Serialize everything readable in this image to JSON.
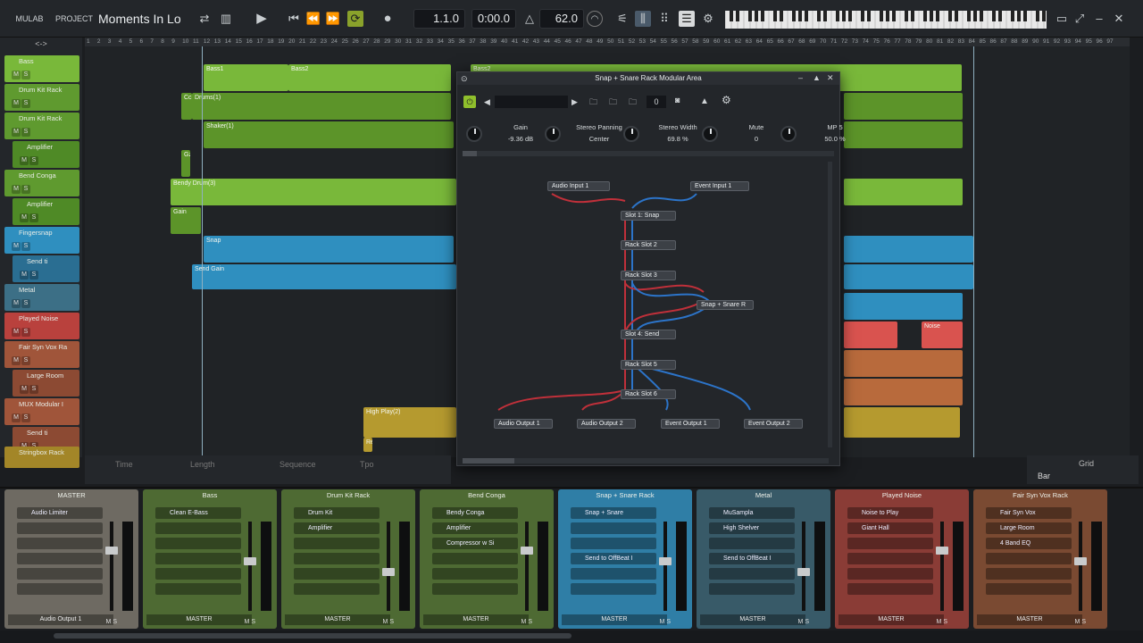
{
  "toolbar": {
    "brand": "MULAB",
    "project": "PROJECT",
    "song_title": "Moments In Lo",
    "position": "1.1.0",
    "time": "0:00.0",
    "tempo": "62.0"
  },
  "tracks": [
    {
      "name": "Bass",
      "color": "#79b83a"
    },
    {
      "name": "Drum Kit Rack",
      "color": "#5f9a2f"
    },
    {
      "name": "Drum Kit Rack",
      "color": "#5f9a2f"
    },
    {
      "name": "Amplifier",
      "color": "#4f8a26"
    },
    {
      "name": "Bend Conga",
      "color": "#5f9a2f"
    },
    {
      "name": "Amplifier",
      "color": "#4f8a26"
    },
    {
      "name": "Fingersnap",
      "color": "#2f8fbf"
    },
    {
      "name": "Send ti",
      "color": "#2a6e92"
    },
    {
      "name": "Metal",
      "color": "#3c6f86"
    },
    {
      "name": "Played Noise",
      "color": "#b9413d"
    },
    {
      "name": "Fair Syn Vox Ra",
      "color": "#a0553a"
    },
    {
      "name": "Large Room",
      "color": "#8c4a33"
    },
    {
      "name": "MUX Modular I",
      "color": "#a0553a"
    },
    {
      "name": "Send ti",
      "color": "#8c4a33"
    },
    {
      "name": "Stringbox Rack",
      "color": "#a38628"
    }
  ],
  "clips": [
    {
      "label": "Bass1"
    },
    {
      "label": "Bass2"
    },
    {
      "label": "Bass2"
    },
    {
      "label": "Drums(1)"
    },
    {
      "label": "Cc"
    },
    {
      "label": "Shaker(1)"
    },
    {
      "label": "Gz"
    },
    {
      "label": "Bendy Drum(3)"
    },
    {
      "label": "Gain"
    },
    {
      "label": "Snap"
    },
    {
      "label": "Send Gain"
    },
    {
      "label": "Noise"
    },
    {
      "label": "High Play(2)"
    },
    {
      "label": "Re"
    }
  ],
  "ruler": [
    "1",
    "2",
    "3",
    "4",
    "5",
    "6",
    "7",
    "8",
    "9",
    "10",
    "11",
    "12",
    "13",
    "14",
    "15",
    "16",
    "17",
    "18",
    "19",
    "20",
    "21",
    "22",
    "23",
    "24",
    "25",
    "26",
    "27",
    "28",
    "29",
    "30",
    "31",
    "32",
    "33",
    "34",
    "35",
    "36",
    "37",
    "38",
    "39",
    "40",
    "41",
    "42",
    "43",
    "44",
    "45",
    "46",
    "47",
    "48",
    "49",
    "50",
    "51",
    "52",
    "53",
    "54",
    "55",
    "56",
    "57",
    "58",
    "59",
    "60",
    "61",
    "62",
    "63",
    "64",
    "65",
    "66",
    "67",
    "68",
    "69",
    "70",
    "71",
    "72",
    "73",
    "74",
    "75",
    "76",
    "77",
    "78",
    "79",
    "80",
    "81",
    "82",
    "83",
    "84",
    "85",
    "86",
    "87",
    "88",
    "89",
    "90",
    "91",
    "92",
    "93",
    "94",
    "95",
    "96",
    "97"
  ],
  "rack": {
    "title": "Snap + Snare Rack Modular Area",
    "preset_number": "0",
    "params": [
      {
        "name": "Gain",
        "value": "-9.36 dB"
      },
      {
        "name": "Stereo Panning",
        "value": "Center"
      },
      {
        "name": "Stereo Width",
        "value": "69.8 %"
      },
      {
        "name": "Mute",
        "value": "0"
      },
      {
        "name": "MP 5",
        "value": "50.0 %"
      }
    ],
    "nodes": {
      "audio_in": "Audio Input 1",
      "event_in": "Event Input 1",
      "slot1": "Slot 1: Snap",
      "slot2": "Rack Slot 2",
      "slot3": "Rack Slot 3",
      "snap": "Snap + Snare R",
      "slot4": "Slot 4: Send",
      "slot5": "Rack Slot 5",
      "slot6": "Rack Slot 6",
      "aout1": "Audio Output 1",
      "aout2": "Audio Output 2",
      "eout1": "Event Output 1",
      "eout2": "Event Output 2"
    }
  },
  "bottom": {
    "time": "Time",
    "length": "Length",
    "sequence": "Sequence",
    "tpo": "Tpo",
    "grid_label": "Grid",
    "grid_value": "Bar"
  },
  "mixer": [
    {
      "name": "MASTER",
      "color": "#6e6a62",
      "slots": [
        "Audio Limiter"
      ],
      "out": "Audio Output 1"
    },
    {
      "name": "Bass",
      "color": "#4e6a33",
      "slots": [
        "Clean E-Bass"
      ],
      "out": "MASTER"
    },
    {
      "name": "Drum Kit Rack",
      "color": "#4e6a33",
      "slots": [
        "Drum Kit",
        "Amplifier"
      ],
      "out": "MASTER"
    },
    {
      "name": "Bend Conga",
      "color": "#4e6a33",
      "slots": [
        "Bendy Conga",
        "Amplifier",
        "Compressor w Si"
      ],
      "out": "MASTER"
    },
    {
      "name": "Snap + Snare Rack",
      "color": "#2f7ea6",
      "slots": [
        "Snap + Snare",
        "",
        "",
        "Send to OffBeat I"
      ],
      "out": "MASTER"
    },
    {
      "name": "Metal",
      "color": "#385a68",
      "slots": [
        "MuSampla",
        "High Shelver",
        "",
        "Send to OffBeat I"
      ],
      "out": "MASTER"
    },
    {
      "name": "Played Noise",
      "color": "#8a3c36",
      "slots": [
        "Noise to Play",
        "Giant Hall"
      ],
      "out": "MASTER"
    },
    {
      "name": "Fair Syn Vox Rack",
      "color": "#7a4a32",
      "slots": [
        "Fair Syn Vox",
        "Large Room",
        "4 Band EQ"
      ],
      "out": "MASTER"
    }
  ]
}
